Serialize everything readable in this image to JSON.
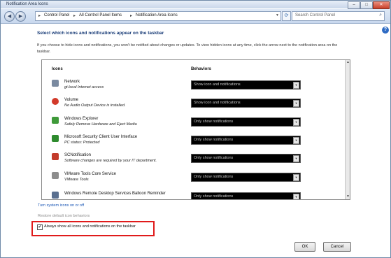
{
  "window": {
    "title": "Notification Area Icons",
    "controls": [
      "–",
      "□",
      "✕"
    ]
  },
  "address": {
    "crumbs": [
      "Control Panel",
      "All Control Panel Items",
      "Notification Area Icons"
    ],
    "sep": "▸"
  },
  "search": {
    "placeholder": "Search Control Panel"
  },
  "help": "?",
  "heading": "Select which icons and notifications appear on the taskbar",
  "description": "If you choose to hide icons and notifications, you won't be notified about changes or updates. To view hidden icons at any time, click the arrow next to the notification area on the taskbar.",
  "table": {
    "col_icons": "Icons",
    "col_behaviors": "Behaviors",
    "rows": [
      {
        "name": "Network",
        "status": "gt.local Internet access",
        "behavior": "Show icon and notifications",
        "icon": "network-icon",
        "color": "#7a8aa0"
      },
      {
        "name": "Volume",
        "status": "No Audio Output Device is installed.",
        "behavior": "Show icon and notifications",
        "icon": "volume-icon",
        "color": "#d23a2a"
      },
      {
        "name": "Windows Explorer",
        "status": "Safely Remove Hardware and Eject Media",
        "behavior": "Only show notifications",
        "icon": "usb-drive-icon",
        "color": "#3f9a3a"
      },
      {
        "name": "Microsoft Security Client User Interface",
        "status": "PC status: Protected",
        "behavior": "Only show notifications",
        "icon": "security-shield-icon",
        "color": "#2e8b2e"
      },
      {
        "name": "SCNotification",
        "status": "Software changes are required by your IT department.",
        "behavior": "Only show notifications",
        "icon": "sc-notification-icon",
        "color": "#c33b2b"
      },
      {
        "name": "VMware Tools Core Service",
        "status": "VMware Tools",
        "behavior": "Only show notifications",
        "icon": "vmware-icon",
        "color": "#8d8d8d"
      },
      {
        "name": "Windows Remote Desktop Services Balloon Reminder",
        "status": "",
        "behavior": "Only show notifications",
        "icon": "remote-desktop-icon",
        "color": "#5a6f8f"
      }
    ]
  },
  "links": {
    "system_icons": "Turn system icons on or off",
    "restore": "Restore default icon behaviors"
  },
  "checkbox": {
    "label": "Always show all icons and notifications on the taskbar",
    "checked": "✔"
  },
  "buttons": {
    "ok": "OK",
    "cancel": "Cancel"
  },
  "colors": {
    "highlight_box": "#e01b1b",
    "link": "#1b57b5",
    "heading": "#1a3d78"
  }
}
